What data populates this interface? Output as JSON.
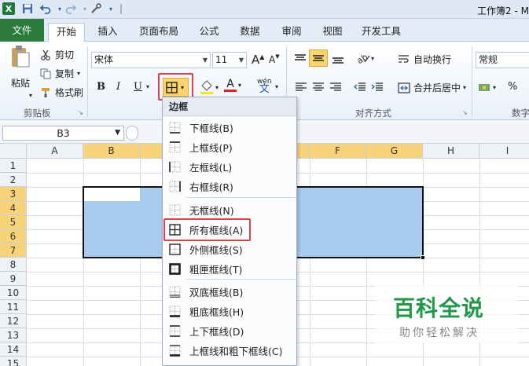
{
  "window": {
    "title": "工作簿2 - M"
  },
  "quick_access": {
    "icons": [
      "excel-logo-icon",
      "save-icon",
      "undo-icon",
      "redo-icon",
      "customize-icon"
    ]
  },
  "ribbon_tabs": [
    {
      "label": "文件"
    },
    {
      "label": "开始"
    },
    {
      "label": "插入"
    },
    {
      "label": "页面布局"
    },
    {
      "label": "公式"
    },
    {
      "label": "数据"
    },
    {
      "label": "审阅"
    },
    {
      "label": "视图"
    },
    {
      "label": "开发工具"
    }
  ],
  "clipboard": {
    "paste": "粘贴",
    "cut": "剪切",
    "copy": "复制",
    "format_painter": "格式刷",
    "group_label": "剪贴板"
  },
  "font": {
    "name": "宋体",
    "size": "11",
    "bold": "B",
    "italic": "I",
    "underline": "U",
    "grow": "A",
    "shrink": "A",
    "phonetic": "wén"
  },
  "alignment": {
    "wrap_text": "自动换行",
    "merge_center": "合并后居中",
    "group_label": "对齐方式"
  },
  "number": {
    "format": "常规",
    "percent": "%",
    "group_label": "数字"
  },
  "formula_bar": {
    "name_box": "B3"
  },
  "sheet": {
    "columns": [
      "A",
      "B",
      "C",
      "D",
      "E",
      "F",
      "G",
      "H",
      "I"
    ],
    "rows": [
      "1",
      "2",
      "3",
      "4",
      "5",
      "6",
      "7",
      "8",
      "9",
      "10",
      "11",
      "12",
      "13",
      "14",
      "15"
    ]
  },
  "border_menu": {
    "header": "边框",
    "items": [
      {
        "label": "下框线(B)",
        "icon": "bottom-border-icon"
      },
      {
        "label": "上框线(P)",
        "icon": "top-border-icon"
      },
      {
        "label": "左框线(L)",
        "icon": "left-border-icon"
      },
      {
        "label": "右框线(R)",
        "icon": "right-border-icon"
      },
      {
        "label": "无框线(N)",
        "icon": "no-border-icon"
      },
      {
        "label": "所有框线(A)",
        "icon": "all-borders-icon"
      },
      {
        "label": "外侧框线(S)",
        "icon": "outside-borders-icon"
      },
      {
        "label": "粗匣框线(T)",
        "icon": "thick-box-border-icon"
      },
      {
        "label": "双底框线(B)",
        "icon": "double-bottom-border-icon"
      },
      {
        "label": "粗底框线(H)",
        "icon": "thick-bottom-border-icon"
      },
      {
        "label": "上下框线(D)",
        "icon": "top-bottom-border-icon"
      },
      {
        "label": "上框线和粗下框线(C)",
        "icon": "top-thick-bottom-border-icon"
      }
    ]
  },
  "watermark": {
    "title": "百科全说",
    "subtitle": "助你轻松解决"
  },
  "colors": {
    "file_tab": "#2a7b3c",
    "selection": "#a9cbf0",
    "header_selected": "#f9d37a",
    "highlight_red": "#e0404a",
    "watermark_green": "#1f9848"
  }
}
